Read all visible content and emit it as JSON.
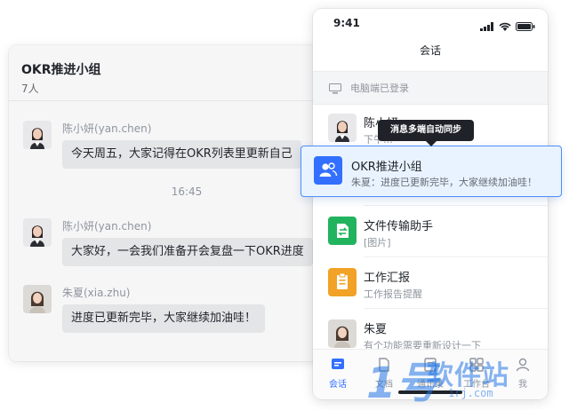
{
  "desktop": {
    "title": "OKR推进小组",
    "member_count": "7人",
    "messages": [
      {
        "sender": "陈小妍(yan.chen)",
        "text": "今天周五，大家记得在OKR列表里更新自己"
      },
      {
        "sender": "陈小妍(yan.chen)",
        "text": "大家好，一会我们准备开会复盘一下OKR进度"
      },
      {
        "sender": "朱夏(xia.zhu)",
        "text": "进度已更新完毕，大家继续加油哇！"
      }
    ],
    "time_separator": "16:45"
  },
  "phone": {
    "status_time": "9:41",
    "nav_title": "会话",
    "pc_login_notice": "电脑端已登录",
    "conversations": [
      {
        "name": "陈小妍",
        "preview": "下午…"
      },
      {
        "name": "OKR推进小组",
        "preview": "朱夏：进度已更新完毕，大家继续加油哇！"
      },
      {
        "name": "文件传输助手",
        "preview": "[图片]"
      },
      {
        "name": "工作汇报",
        "preview": "工作报告提醒"
      },
      {
        "name": "朱夏",
        "preview": "有个功能需要重新设计一下"
      }
    ],
    "tabs": [
      {
        "label": "会话",
        "icon": "chat-icon",
        "active": true
      },
      {
        "label": "文档",
        "icon": "doc-icon",
        "active": false
      },
      {
        "label": "通讯录",
        "icon": "contacts-icon",
        "active": false
      },
      {
        "label": "工作台",
        "icon": "workbench-icon",
        "active": false
      },
      {
        "label": "我",
        "icon": "profile-icon",
        "active": false
      }
    ]
  },
  "tooltip": "消息多端自动同步",
  "watermark": {
    "number": "1号",
    "text": "软件站",
    "url": "1rj.com"
  },
  "colors": {
    "accent": "#3370ff",
    "file_green": "#22b35e",
    "report_orange": "#f2a227",
    "highlight_bg": "#e9f3ff"
  }
}
